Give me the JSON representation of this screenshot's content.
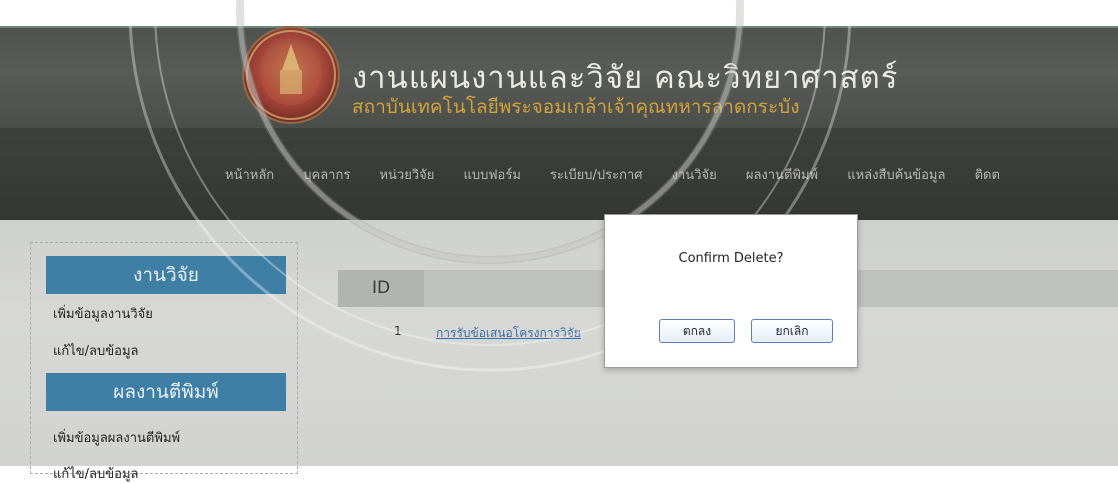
{
  "header": {
    "title": "งานแผนงานและวิจัย คณะวิทยาศาสตร์",
    "subtitle": "สถาบันเทคโนโลยีพระจอมเกล้าเจ้าคุณทหารลาดกระบัง"
  },
  "nav": {
    "items": [
      {
        "label": "หน้าหลัก"
      },
      {
        "label": "บุคลากร"
      },
      {
        "label": "หน่วยวิจัย"
      },
      {
        "label": "แบบฟอร์ม"
      },
      {
        "label": "ระเบียบ/ประกาศ"
      },
      {
        "label": "งานวิจัย"
      },
      {
        "label": "ผลงานตีพิมพ์"
      },
      {
        "label": "แหล่งสืบค้นข้อมูล"
      },
      {
        "label": "ติดต"
      }
    ]
  },
  "sidebar": {
    "sections": [
      {
        "header": "งานวิจัย",
        "links": [
          "เพิ่มข้อมูลงานวิจัย",
          "แก้ไข/ลบข้อมูล"
        ]
      },
      {
        "header": "ผลงานตีพิมพ์",
        "links": [
          "เพิ่มข้อมูลผลงานตีพิมพ์",
          "แก้ไข/ลบข้อมูล"
        ]
      }
    ]
  },
  "table": {
    "header_id": "ID",
    "rows": [
      {
        "id": "1",
        "title": "การรับข้อเสนอโครงการวิจัย"
      }
    ]
  },
  "dialog": {
    "message": "Confirm Delete?",
    "ok_label": "ตกลง",
    "cancel_label": "ยกเลิก"
  },
  "colors": {
    "sidebar_header": "#3f7fa6",
    "header_bg": "#535652",
    "subtitle": "#d2a33d",
    "link": "#3c6da8"
  }
}
